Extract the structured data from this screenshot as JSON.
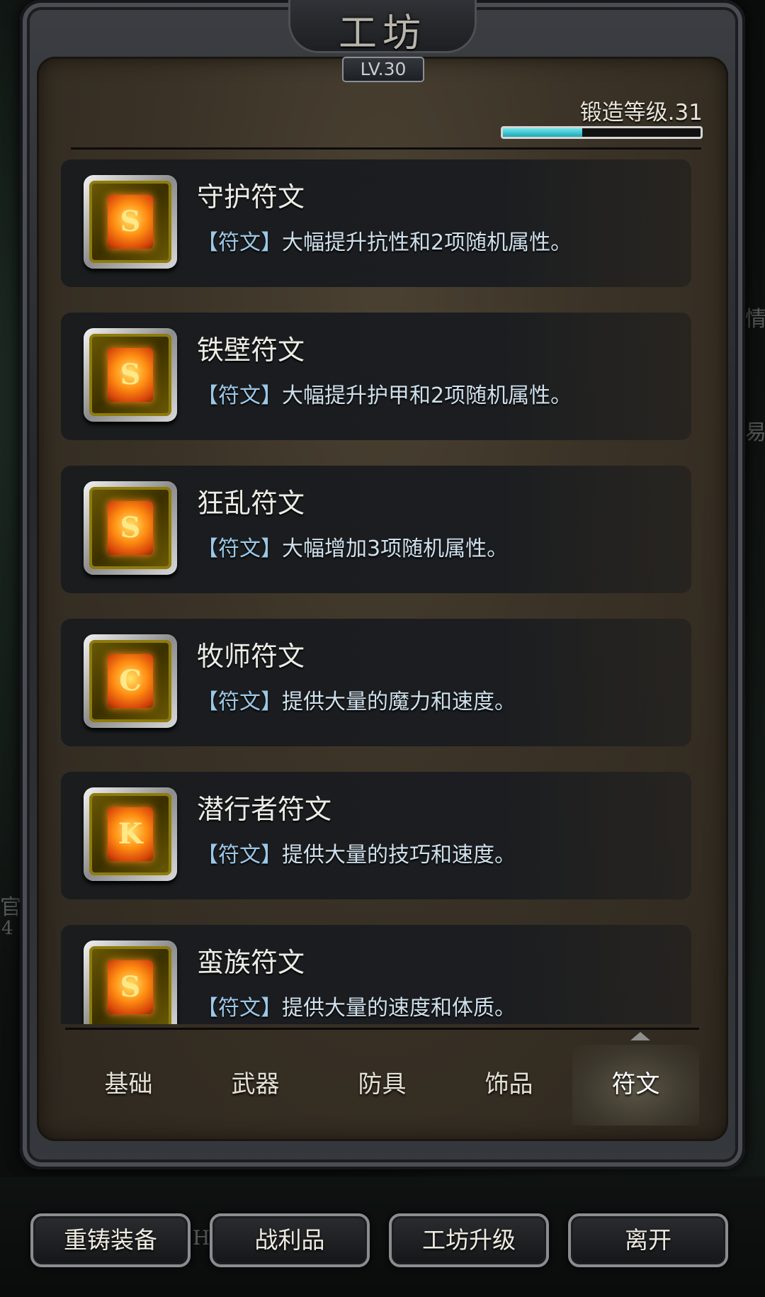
{
  "header": {
    "title": "工坊",
    "level": "LV.30",
    "forge_level_label": "锻造等级.31",
    "forge_progress": 0.4
  },
  "runes": [
    {
      "name": "守护符文",
      "tag": "【符文】",
      "desc": "大幅提升抗性和2项随机属性。",
      "glyph": "S"
    },
    {
      "name": "铁壁符文",
      "tag": "【符文】",
      "desc": "大幅提升护甲和2项随机属性。",
      "glyph": "S"
    },
    {
      "name": "狂乱符文",
      "tag": "【符文】",
      "desc": "大幅增加3项随机属性。",
      "glyph": "S"
    },
    {
      "name": "牧师符文",
      "tag": "【符文】",
      "desc": "提供大量的魔力和速度。",
      "glyph": "C"
    },
    {
      "name": "潜行者符文",
      "tag": "【符文】",
      "desc": "提供大量的技巧和速度。",
      "glyph": "K"
    },
    {
      "name": "蛮族符文",
      "tag": "【符文】",
      "desc": "提供大量的速度和体质。",
      "glyph": "S"
    }
  ],
  "tabs": [
    {
      "label": "基础",
      "active": false
    },
    {
      "label": "武器",
      "active": false
    },
    {
      "label": "防具",
      "active": false
    },
    {
      "label": "饰品",
      "active": false
    },
    {
      "label": "符文",
      "active": true
    }
  ],
  "actions": {
    "recast": "重铸装备",
    "loot": "战利品",
    "upgrade": "工坊升级",
    "leave": "离开"
  },
  "background": {
    "left_text_1": "官",
    "left_text_2": "4",
    "right_text_1": "情",
    "right_text_2": "易",
    "mid_text": "H"
  },
  "colors": {
    "progress_fill": "#1fa7b4",
    "rune_tag": "#9cc7e6",
    "panel_bg": "#3a3226"
  }
}
